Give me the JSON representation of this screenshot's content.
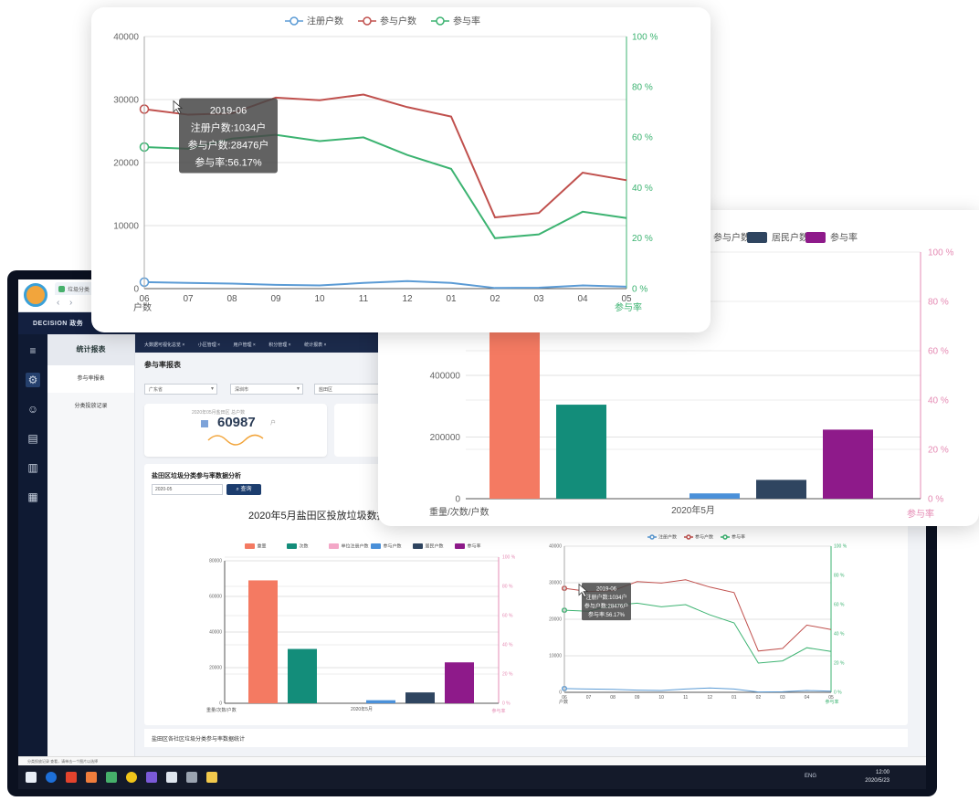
{
  "browser": {
    "tab_title": "垃圾分类",
    "back": "‹",
    "forward": "›"
  },
  "app": {
    "logo_text": "DECISION 政务",
    "left_icons": [
      "menu-icon",
      "gear-icon",
      "users-icon",
      "calendar-icon",
      "bar-chart-icon",
      "calendar-icon"
    ],
    "submenu": {
      "title": "统计报表",
      "items": [
        "参与率报表",
        "分类投放记录"
      ]
    },
    "tabs": [
      "大数据可视化总览 ×",
      "小区管理 ×",
      "用户管理 ×",
      "积分管理 ×",
      "统计报表 ×"
    ],
    "report_title": "参与率报表",
    "filters": [
      "广东省",
      "深圳市",
      "盐田区",
      ""
    ],
    "stat_card": {
      "caption": "2020年05月盐田区 总户数",
      "value": "60987",
      "unit": "户"
    },
    "panel": {
      "title": "盐田区垃圾分类参与率数据分析",
      "date": "2020-05",
      "query_button": "查询",
      "chart_title": "2020年5月盐田区投放垃圾数据分析统计"
    },
    "bottom_title": "盐田区各社区垃圾分类参与率数据统计",
    "status_text": "分类投放记录 查看，请单击一个图片以选择"
  },
  "taskbar": {
    "tray": "ENG",
    "time": "12:00",
    "date": "2020/5/23"
  },
  "colors": {
    "registered": "#5b9bd5",
    "participating": "#c0504d",
    "rate": "#3cb371",
    "weight": "#f47a62",
    "count": "#138d7a",
    "pink": "#f3a7c7",
    "blue": "#4a90d9",
    "residents": "#2f4560",
    "purple": "#8e1a8a"
  },
  "chart_data": [
    {
      "type": "line",
      "legend": [
        "注册户数",
        "参与户数",
        "参与率"
      ],
      "x": [
        "06",
        "07",
        "08",
        "09",
        "10",
        "11",
        "12",
        "01",
        "02",
        "03",
        "04",
        "05"
      ],
      "ylabel": "户数",
      "y2label": "参与率",
      "ylim": [
        0,
        40000
      ],
      "y2lim": [
        0,
        100
      ],
      "yticks": [
        "0",
        "10000",
        "20000",
        "30000",
        "40000"
      ],
      "y2ticks": [
        "0 %",
        "20 %",
        "40 %",
        "60 %",
        "80 %",
        "100 %"
      ],
      "series": [
        {
          "name": "注册户数",
          "axis": "left",
          "values": [
            1034,
            900,
            800,
            600,
            500,
            900,
            1200,
            900,
            100,
            150,
            500,
            300
          ]
        },
        {
          "name": "参与户数",
          "axis": "left",
          "values": [
            28476,
            27600,
            27800,
            30300,
            29900,
            30800,
            28800,
            27300,
            11300,
            12000,
            18400,
            17200
          ]
        },
        {
          "name": "参与率",
          "axis": "right",
          "values": [
            56.17,
            55.5,
            59.5,
            61.0,
            58.5,
            60.0,
            53.0,
            47.5,
            20.0,
            21.5,
            30.5,
            28.0
          ]
        }
      ],
      "tooltip": {
        "title": "2019-06",
        "lines": [
          "注册户数:1034户",
          "参与户数:28476户",
          "参与率:56.17%"
        ]
      }
    },
    {
      "type": "bar",
      "legend": [
        "参与户数",
        "居民户数",
        "参与率"
      ],
      "categories": [
        "2020年5月"
      ],
      "xlabel": "2020年5月",
      "ylabel": "重量/次数/户数",
      "y2label": "参与率",
      "ylim": [
        0,
        800000
      ],
      "yticks": [
        "0",
        "200000",
        "400000"
      ],
      "y2ticks": [
        "0 %",
        "20 %",
        "40 %",
        "60 %",
        "80 %",
        "100 %"
      ],
      "series": [
        {
          "name": "重量",
          "values": [
            690000
          ]
        },
        {
          "name": "次数",
          "values": [
            305000
          ]
        },
        {
          "name": "单位注册户数",
          "values": [
            0
          ]
        },
        {
          "name": "参与户数",
          "values": [
            17200
          ]
        },
        {
          "name": "居民户数",
          "values": [
            60987
          ]
        },
        {
          "name": "参与率",
          "values": [
            28
          ]
        }
      ]
    },
    {
      "type": "bar",
      "legend": [
        "重量",
        "次数",
        "单位注册户数",
        "参与户数",
        "居民户数",
        "参与率"
      ],
      "categories": [
        "2020年5月"
      ],
      "xlabel": "2020年5月",
      "ylabel": "重量/次数/户数",
      "y2label": "参与率",
      "ylim": [
        0,
        80000
      ],
      "yticks": [
        "0",
        "20000",
        "40000",
        "60000",
        "80000"
      ],
      "y2ticks": [
        "0 %",
        "20 %",
        "40 %",
        "60 %",
        "80 %",
        "100 %"
      ],
      "series": [
        {
          "name": "重量",
          "values": [
            69000
          ]
        },
        {
          "name": "次数",
          "values": [
            30500
          ]
        },
        {
          "name": "单位注册户数",
          "values": [
            0
          ]
        },
        {
          "name": "参与户数",
          "values": [
            1720
          ]
        },
        {
          "name": "居民户数",
          "values": [
            6098
          ]
        },
        {
          "name": "参与率",
          "values": [
            28
          ]
        }
      ]
    },
    {
      "type": "line",
      "legend": [
        "注册户数",
        "参与户数",
        "参与率"
      ],
      "x": [
        "06",
        "07",
        "08",
        "09",
        "10",
        "11",
        "12",
        "01",
        "02",
        "03",
        "04",
        "05"
      ],
      "ylabel": "户数",
      "y2label": "参与率",
      "ylim": [
        0,
        40000
      ],
      "y2lim": [
        0,
        100
      ],
      "yticks": [
        "0",
        "10000",
        "20000",
        "30000",
        "40000"
      ],
      "y2ticks": [
        "0 %",
        "20 %",
        "40 %",
        "60 %",
        "80 %",
        "100 %"
      ],
      "tooltip": {
        "title": "2019-06",
        "lines": [
          "注册户数:1034户",
          "参与户数:28476户",
          "参与率:56.17%"
        ]
      }
    }
  ]
}
